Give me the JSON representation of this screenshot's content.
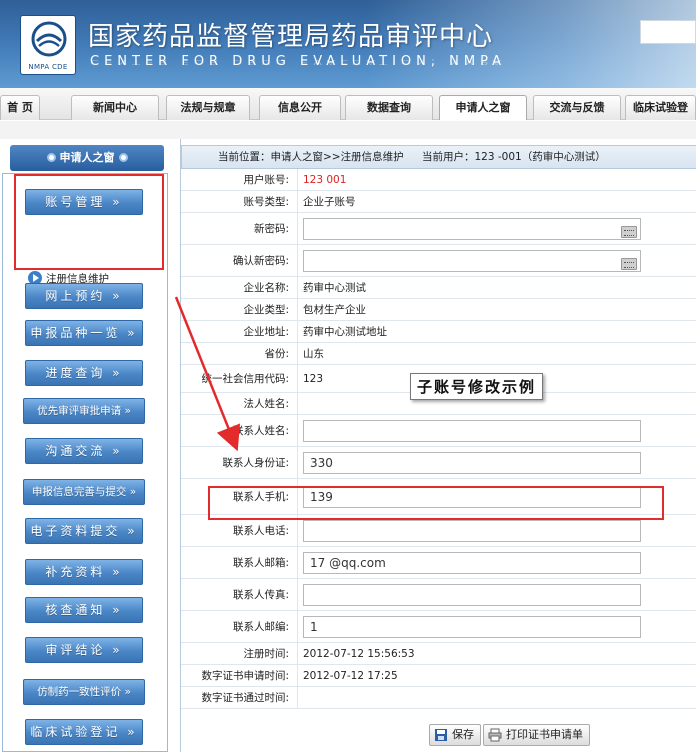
{
  "header": {
    "title_cn": "国家药品监督管理局药品审评中心",
    "title_en": "CENTER FOR DRUG EVALUATION, NMPA",
    "logo_text": "NMPA CDE"
  },
  "nav": {
    "tabs": [
      "首 页",
      "新闻中心",
      "法规与规章",
      "信息公开",
      "数据查询",
      "申请人之窗",
      "交流与反馈",
      "临床试验登"
    ],
    "active": "申请人之窗"
  },
  "sidebar": {
    "header": "申请人之窗",
    "account_button": "账号管理  »",
    "sub_item": "注册信息维护",
    "buttons": [
      "网上预约  »",
      "申报品种一览 »",
      "进度查询  »",
      "优先审评审批申请 »",
      "沟通交流  »",
      "申报信息完善与提交 »",
      "电子资料提交 »",
      "补充资料  »",
      "核查通知  »",
      "审评结论  »",
      "仿制药一致性评价 »",
      "临床试验登记 »"
    ]
  },
  "main": {
    "breadcrumb": "当前位置：申请人之窗>>注册信息维护",
    "current_user": "当前用户：123           -001（药审中心测试）",
    "annotation": "子账号修改示例",
    "rows": {
      "user_account": {
        "label": "用户账号:",
        "value": "123           001"
      },
      "account_type": {
        "label": "账号类型:",
        "value": "企业子账号"
      },
      "new_password": {
        "label": "新密码:",
        "value": ""
      },
      "confirm_password": {
        "label": "确认新密码:",
        "value": ""
      },
      "company_name": {
        "label": "企业名称:",
        "value": "药审中心测试"
      },
      "company_type": {
        "label": "企业类型:",
        "value": "包材生产企业"
      },
      "company_address": {
        "label": "企业地址:",
        "value": "药审中心测试地址"
      },
      "province": {
        "label": "省份:",
        "value": "山东"
      },
      "credit_code": {
        "label": "统一社会信用代码:",
        "value": "123"
      },
      "legal_name": {
        "label": "法人姓名:",
        "value": ""
      },
      "contact_name": {
        "label": "联系人姓名:",
        "value": ""
      },
      "contact_id": {
        "label": "联系人身份证:",
        "value": "330"
      },
      "contact_mobile": {
        "label": "联系人手机:",
        "value": "139"
      },
      "contact_phone": {
        "label": "联系人电话:",
        "value": ""
      },
      "contact_email": {
        "label": "联系人邮箱:",
        "value": "17            @qq.com"
      },
      "contact_fax": {
        "label": "联系人传真:",
        "value": ""
      },
      "contact_zip": {
        "label": "联系人邮编:",
        "value": "1"
      },
      "register_time": {
        "label": "注册时间:",
        "value": "2012-07-12 15:56:53"
      },
      "cert_apply_time": {
        "label": "数字证书申请时间:",
        "value": "2012-07-12 17:25"
      },
      "cert_pass_time": {
        "label": "数字证书通过时间:",
        "value": ""
      }
    },
    "save_button": "保存",
    "print_button": "打印证书申请单"
  },
  "colors": {
    "header_blue": "#3f78b5",
    "sidebar_button": "#4a86c6",
    "highlight_red": "#e32b2b",
    "account_red": "#d22"
  }
}
